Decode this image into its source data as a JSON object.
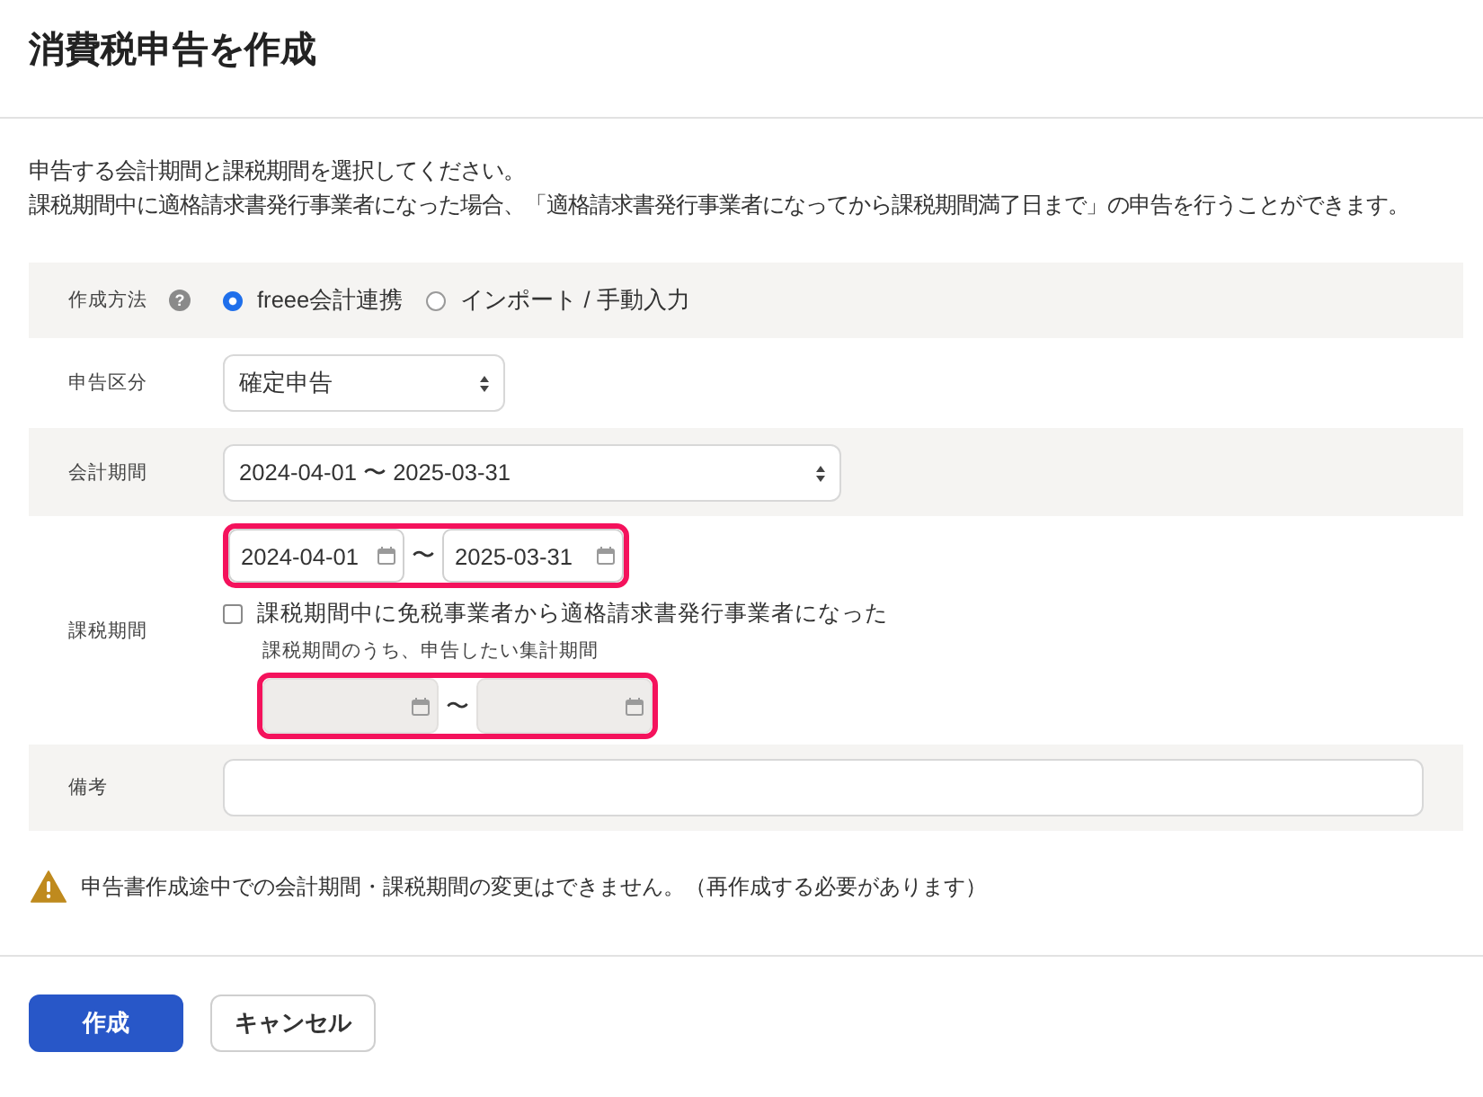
{
  "dialog": {
    "title": "消費税申告を作成"
  },
  "description": [
    "申告する会計期間と課税期間を選択してください。",
    "課税期間中に適格請求書発行事業者になった場合、「適格請求書発行事業者になってから課税期間満了日まで」の申告を行うことができます。"
  ],
  "form": {
    "rows": [
      {
        "kind": "radio",
        "label": "作成方法",
        "help": "?",
        "options": [
          {
            "label": "freee会計連携",
            "selected": true
          },
          {
            "label": "インポート / 手動入力",
            "selected": false
          }
        ]
      },
      {
        "kind": "select",
        "label": "申告区分",
        "value": "確定申告"
      },
      {
        "kind": "select",
        "label": "会計期間",
        "value": "2024-04-01 〜 2025-03-31"
      },
      {
        "kind": "period",
        "label": "課税期間",
        "range": {
          "start": "2024-04-01",
          "separator": "〜",
          "end": "2025-03-31",
          "disabled": false,
          "highlighted": true
        },
        "checkbox": {
          "label": "課税期間中に免税事業者から適格請求書発行事業者になった",
          "checked": false
        },
        "sub_label": "課税期間のうち、申告したい集計期間",
        "sub_range": {
          "separator": "〜",
          "disabled": true,
          "highlighted": true
        }
      },
      {
        "kind": "text",
        "label": "備考"
      }
    ]
  },
  "warning": {
    "text": "申告書作成途中での会計期間・課税期間の変更はできません。（再作成する必要があります）"
  },
  "buttons": [
    {
      "label": "作成",
      "kind": "primary"
    },
    {
      "label": "キャンセル",
      "kind": "secondary"
    }
  ]
}
